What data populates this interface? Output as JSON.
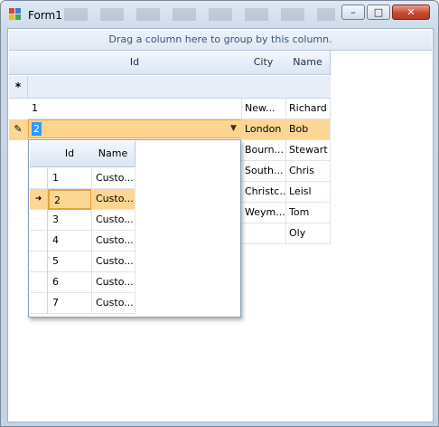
{
  "window": {
    "title": "Form1",
    "minimize": "–",
    "maximize": "□",
    "close": "✕"
  },
  "grid": {
    "group_panel_text": "Drag a column here to group by this column.",
    "columns": [
      "Id",
      "City",
      "Name"
    ],
    "new_row_indicator": "*",
    "editing_indicator": "✎",
    "rows": [
      {
        "id": "1",
        "city": "New...",
        "name": "Richard"
      },
      {
        "id": "2",
        "city": "London",
        "name": "Bob"
      },
      {
        "id": "",
        "city": "Bourn...",
        "name": "Stewart"
      },
      {
        "id": "",
        "city": "South...",
        "name": "Chris"
      },
      {
        "id": "",
        "city": "Christc...",
        "name": "Leisl"
      },
      {
        "id": "",
        "city": "Weym...",
        "name": "Tom"
      },
      {
        "id": "",
        "city": "",
        "name": "Oly"
      }
    ],
    "editor_value": "2",
    "dropdown_arrow": "▼"
  },
  "popup": {
    "columns": [
      "Id",
      "Name"
    ],
    "current_indicator": "➜",
    "rows": [
      {
        "id": "1",
        "name": "Custo..."
      },
      {
        "id": "2",
        "name": "Custo..."
      },
      {
        "id": "3",
        "name": "Custo..."
      },
      {
        "id": "4",
        "name": "Custo..."
      },
      {
        "id": "5",
        "name": "Custo..."
      },
      {
        "id": "6",
        "name": "Custo..."
      },
      {
        "id": "7",
        "name": "Custo..."
      }
    ]
  }
}
